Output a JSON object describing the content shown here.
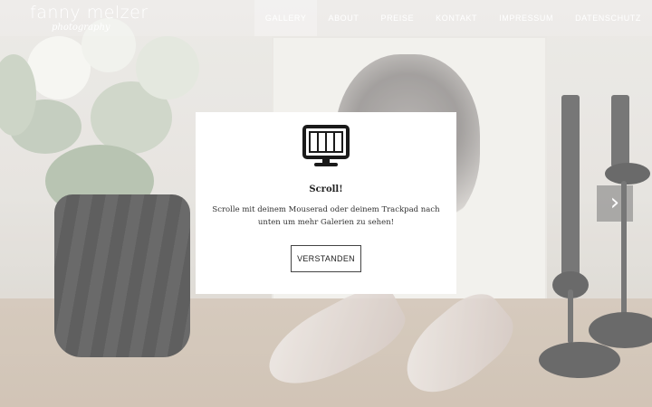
{
  "brand": {
    "name": "fanny melzer",
    "tagline": "photography"
  },
  "nav": {
    "items": [
      {
        "label": "GALLERY",
        "active": true
      },
      {
        "label": "ABOUT",
        "active": false
      },
      {
        "label": "PREISE",
        "active": false
      },
      {
        "label": "KONTAKT",
        "active": false
      },
      {
        "label": "IMPRESSUM",
        "active": false
      },
      {
        "label": "DATENSCHUTZ",
        "active": false
      }
    ]
  },
  "slider": {
    "next_icon": "chevron-right-icon"
  },
  "modal": {
    "icon": "monitor-icon",
    "title": "Scroll!",
    "text": "Scrolle mit deinem Mouserad oder deinem Trackpad nach unten um mehr Galerien zu sehen!",
    "button_label": "VERSTANDEN"
  },
  "colors": {
    "modal_bg": "#ffffff",
    "text": "#222222",
    "nav_text": "#ffffff"
  }
}
